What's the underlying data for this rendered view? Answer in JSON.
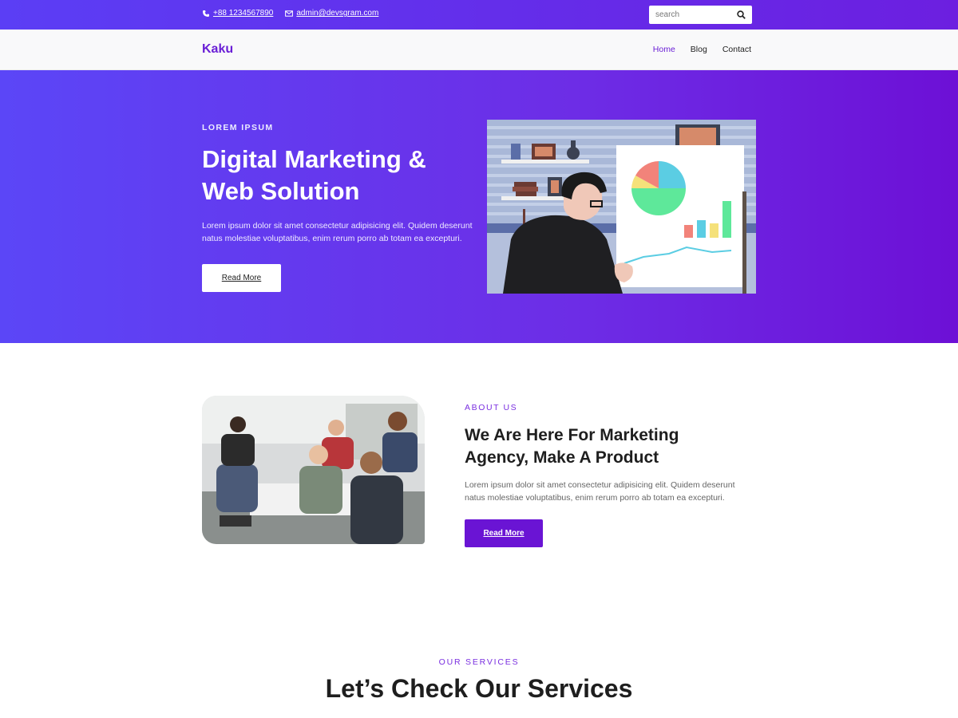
{
  "topbar": {
    "phone": "+88 1234567890",
    "email": "admin@devsgram.com",
    "search_placeholder": "search",
    "icons": {
      "phone": "phone-icon",
      "email": "envelope-icon",
      "search": "search-icon"
    }
  },
  "navbar": {
    "brand": "Kaku",
    "links": [
      {
        "label": "Home",
        "active": true
      },
      {
        "label": "Blog",
        "active": false
      },
      {
        "label": "Contact",
        "active": false
      }
    ]
  },
  "hero": {
    "kicker": "LOREM IPSUM",
    "title_line1": "Digital Marketing &",
    "title_line2": "Web Solution",
    "description": "Lorem ipsum dolor sit amet consectetur adipisicing elit. Quidem deserunt natus molestiae voluptatibus, enim rerum porro ab totam ea excepturi.",
    "button_label": "Read More"
  },
  "about": {
    "kicker": "ABOUT US",
    "title_line1": "We Are Here For Marketing",
    "title_line2": "Agency, Make A Product",
    "description": "Lorem ipsum dolor sit amet consectetur adipisicing elit. Quidem deserunt natus molestiae voluptatibus, enim rerum porro ab totam ea excepturi.",
    "button_label": "Read More"
  },
  "services": {
    "kicker": "OUR SERVICES",
    "title": "Let’s Check Our Services"
  },
  "colors": {
    "brand": "#6a1fd6",
    "gradient_start": "#5b46f7",
    "gradient_end": "#6d10d6",
    "button_dark": "#6a14d4"
  }
}
